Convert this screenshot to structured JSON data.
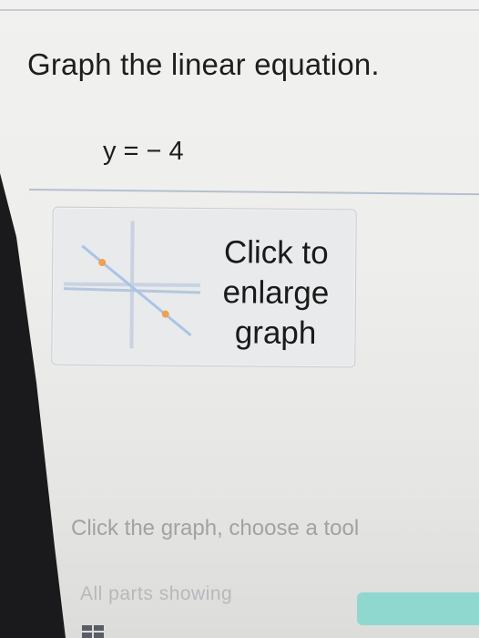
{
  "question": {
    "title": "Graph the linear equation.",
    "equation": "y = − 4"
  },
  "graph_card": {
    "line1": "Click to",
    "line2": "enlarge",
    "line3": "graph"
  },
  "footer": {
    "instruction": "Click the graph, choose a tool",
    "parts_status": "All parts showing"
  },
  "colors": {
    "accent_teal": "#8fd8cf",
    "point_marker": "#f0a050",
    "thumbnail_line": "#a9c4e6"
  },
  "icons": {
    "thumbnail": "graph-thumbnail-icon",
    "taskbar": "windows-start-icon"
  }
}
